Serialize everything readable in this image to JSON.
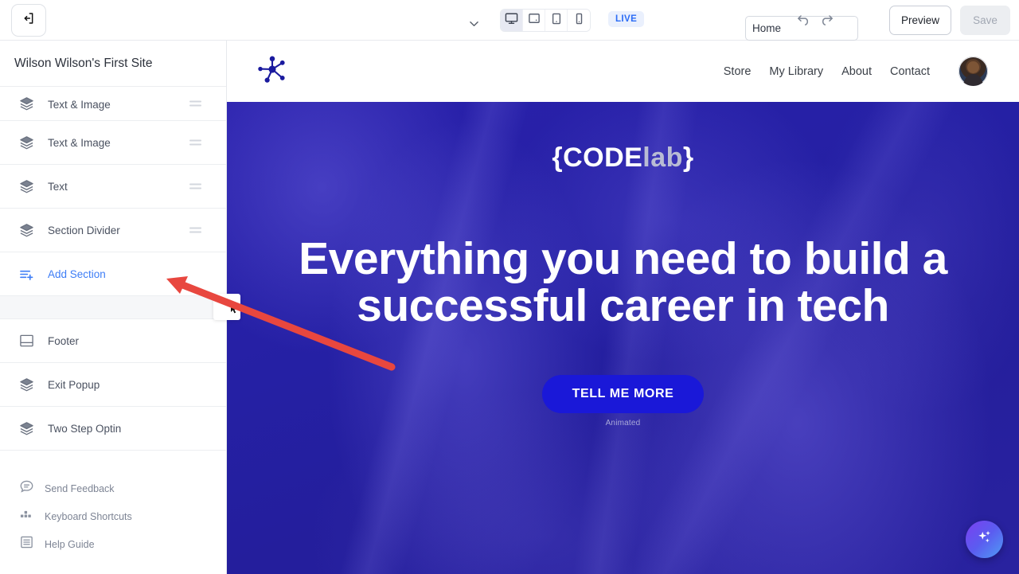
{
  "toolbar": {
    "exit_icon": "exit-logout-icon",
    "page_selector": {
      "value": "Home",
      "options": [
        "Home"
      ]
    },
    "devices": [
      {
        "name": "desktop",
        "icon": "desktop-icon",
        "active": true
      },
      {
        "name": "laptop",
        "icon": "laptop-icon",
        "active": false
      },
      {
        "name": "tablet",
        "icon": "tablet-icon",
        "active": false
      },
      {
        "name": "mobile",
        "icon": "mobile-icon",
        "active": false
      }
    ],
    "live_badge": "LIVE",
    "undo_icon": "undo-arrow-icon",
    "redo_icon": "redo-arrow-icon",
    "preview_label": "Preview",
    "save_label": "Save"
  },
  "sidebar": {
    "site_title": "Wilson Wilson's First Site",
    "sections": [
      {
        "label": "Text & Image",
        "icon": "layers-icon",
        "clipped": true
      },
      {
        "label": "Text & Image",
        "icon": "layers-icon",
        "clipped": false
      },
      {
        "label": "Text",
        "icon": "layers-icon",
        "clipped": false
      },
      {
        "label": "Section Divider",
        "icon": "layers-icon",
        "clipped": false
      }
    ],
    "add_section": {
      "label": "Add Section",
      "icon": "list-plus-icon"
    },
    "blocks": [
      {
        "label": "Footer",
        "icon": "footer-layout-icon"
      },
      {
        "label": "Exit Popup",
        "icon": "layers-icon"
      },
      {
        "label": "Two Step Optin",
        "icon": "layers-icon"
      }
    ],
    "links": [
      {
        "label": "Send Feedback",
        "icon": "chat-bubble-icon"
      },
      {
        "label": "Keyboard Shortcuts",
        "icon": "keyboard-keys-icon"
      },
      {
        "label": "Help Guide",
        "icon": "document-list-icon"
      }
    ]
  },
  "preview": {
    "logo_icon": "network-node-logo-icon",
    "nav": [
      "Store",
      "My Library",
      "About",
      "Contact"
    ],
    "avatar": "user-avatar",
    "brand": {
      "open": "{",
      "code": "CODE",
      "lab": "lab",
      "close": "}"
    },
    "headline": "Everything you need to build a successful career in tech",
    "cta_label": "TELL ME MORE",
    "cta_caption": "Animated",
    "ai_button_icon": "sparkles-icon"
  },
  "colors": {
    "accent_blue": "#3d7df6",
    "hero_bg": "#2520a4",
    "cta_bg": "#1a18d8",
    "annotation_red": "#e8473f",
    "live_text": "#2b6cf6"
  }
}
